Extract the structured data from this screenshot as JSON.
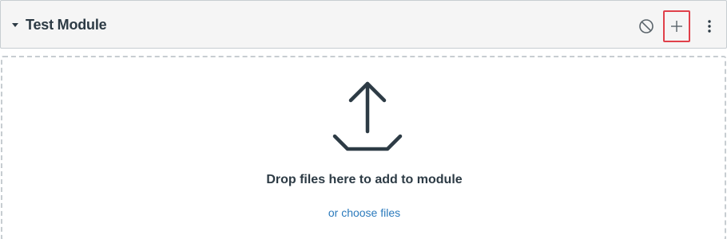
{
  "module": {
    "title": "Test Module"
  },
  "header_actions": {
    "collapse_icon": "caret-down-icon",
    "unpublish_icon": "no-entry-icon",
    "add_icon": "plus-icon",
    "more_icon": "kebab-menu-icon",
    "highlight_color": "#e0404a"
  },
  "dropzone": {
    "icon": "upload-icon",
    "message": "Drop files here to add to module",
    "choose_link": "or choose files",
    "link_color": "#2b7abc"
  }
}
